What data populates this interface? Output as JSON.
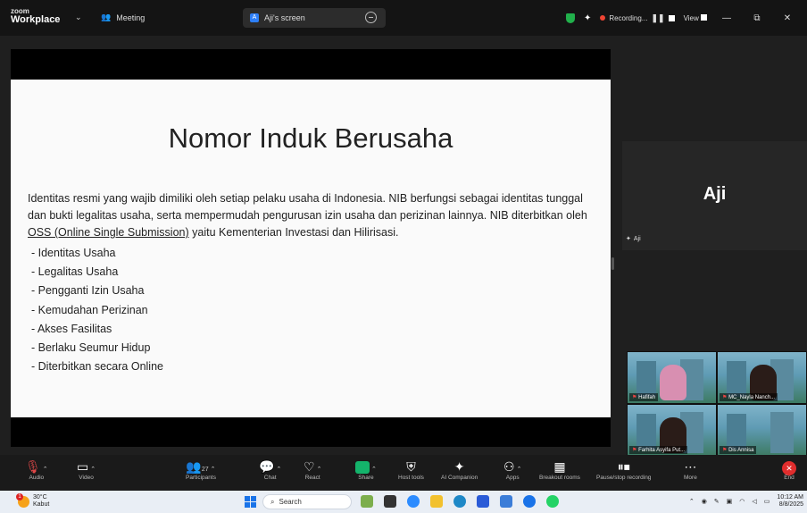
{
  "titlebar": {
    "brand_top": "zoom",
    "brand_bottom": "Workplace",
    "meeting_label": "Meeting",
    "share_tab_label": "Aji's screen",
    "recording_label": "Recording...",
    "view_label": "View",
    "window_minimize": "—",
    "window_restore": "⧉",
    "window_close": "✕"
  },
  "slide": {
    "title": "Nomor Induk Berusaha",
    "para_pre": "Identitas resmi yang wajib dimiliki oleh setiap pelaku usaha di Indonesia. NIB berfungsi sebagai identitas tunggal dan bukti legalitas usaha, serta mempermudah pengurusan izin usaha dan perizinan lainnya. NIB diterbitkan oleh ",
    "para_link": "OSS (Online Single Submission)",
    "para_post": " yaitu Kementerian Investasi dan Hilirisasi.",
    "items": [
      "- Identitas Usaha",
      "- Legalitas Usaha",
      "- Pengganti Izin Usaha",
      "- Kemudahan Perizinan",
      "- Akses Fasilitas",
      "- Berlaku Seumur Hidup",
      "- Diterbitkan secara Online"
    ]
  },
  "speaker": {
    "name": "Aji",
    "tag": "Aji"
  },
  "gallery": [
    {
      "name": "Hafifah"
    },
    {
      "name": "MC_Nayla Nanch..."
    },
    {
      "name": "Farhita Asyifa Put..."
    },
    {
      "name": "Dis Annisa"
    }
  ],
  "toolbar": {
    "audio": "Audio",
    "video": "Video",
    "participants": "Participants",
    "participants_count": "27",
    "chat": "Chat",
    "react": "React",
    "share": "Share",
    "host_tools": "Host tools",
    "ai_companion": "AI Companion",
    "apps": "Apps",
    "breakout_rooms": "Breakout rooms",
    "pause_recording": "Pause/stop recording",
    "more": "More",
    "end": "End"
  },
  "taskbar": {
    "temperature": "30°C",
    "weather": "Kabut",
    "weather_badge": "1",
    "search_placeholder": "Search",
    "time": "10:12 AM",
    "date": "8/8/2025"
  },
  "colors": {
    "share_green": "#14b36b",
    "end_red": "#e02d2d",
    "record_red": "#ee4433",
    "security_green": "#21b04b"
  }
}
